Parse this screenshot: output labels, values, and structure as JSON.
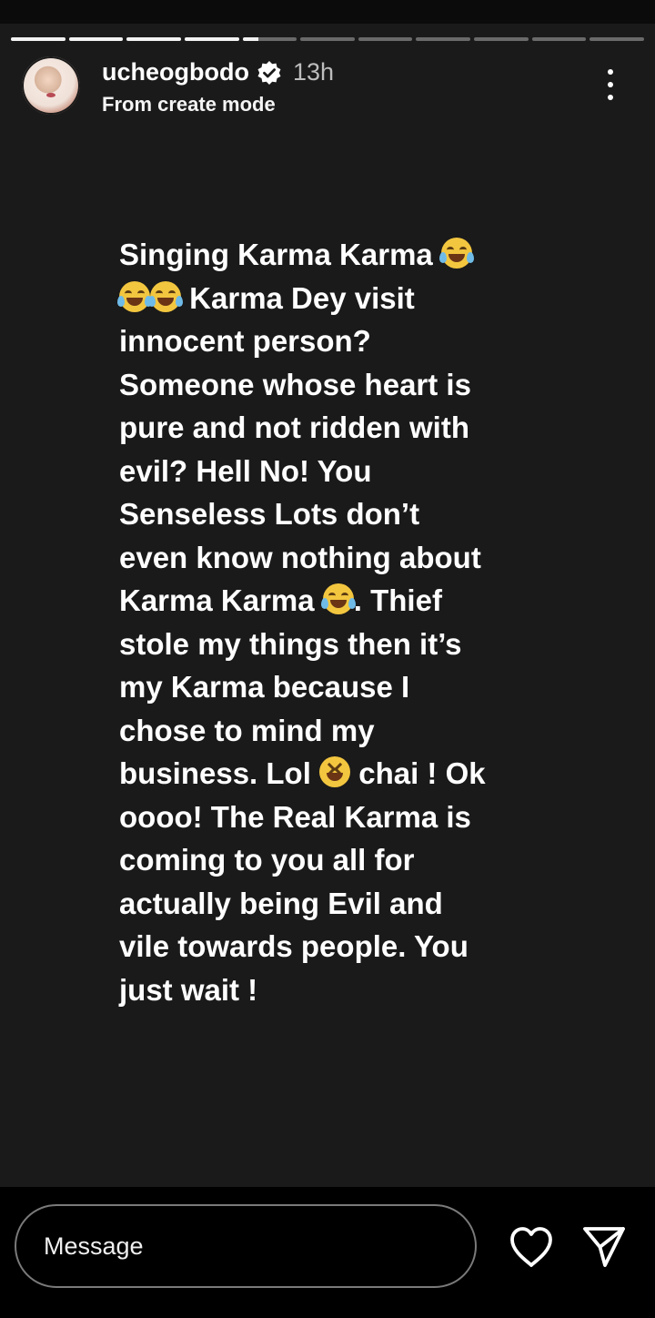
{
  "story": {
    "progress_segments": [
      1,
      1,
      1,
      1,
      0.3,
      0,
      0,
      0,
      0,
      0,
      0
    ],
    "background_color": "#1a1a1a"
  },
  "header": {
    "username": "ucheogbodo",
    "verified_icon": "verified-badge-icon",
    "time_ago": "13h",
    "subtitle": "From create mode",
    "menu_icon": "more-options-icon"
  },
  "body": {
    "lines": [
      [
        "Singing Karma Karma ",
        "😂"
      ],
      [
        "😂",
        "😂",
        " Karma Dey visit"
      ],
      [
        "innocent person?"
      ],
      [
        "Someone whose heart is"
      ],
      [
        "pure and not ridden with"
      ],
      [
        "evil? Hell No! You"
      ],
      [
        "Senseless Lots don’t"
      ],
      [
        "even know nothing about"
      ],
      [
        "Karma Karma ",
        "😂",
        ". Thief"
      ],
      [
        "stole my things then it’s"
      ],
      [
        "my Karma because I"
      ],
      [
        "chose to mind my"
      ],
      [
        "business. Lol ",
        "😆",
        " chai ! Ok"
      ],
      [
        "oooo! The Real Karma is"
      ],
      [
        "coming to you all for"
      ],
      [
        "actually being Evil and"
      ],
      [
        "vile towards people. You"
      ],
      [
        "just wait !"
      ]
    ],
    "emoji_icons": {
      "😂": "face-with-tears-of-joy-icon",
      "😆": "grinning-squinting-face-icon"
    }
  },
  "footer": {
    "message_placeholder": "Message",
    "message_value": "",
    "like_icon": "heart-icon",
    "send_icon": "send-icon"
  }
}
